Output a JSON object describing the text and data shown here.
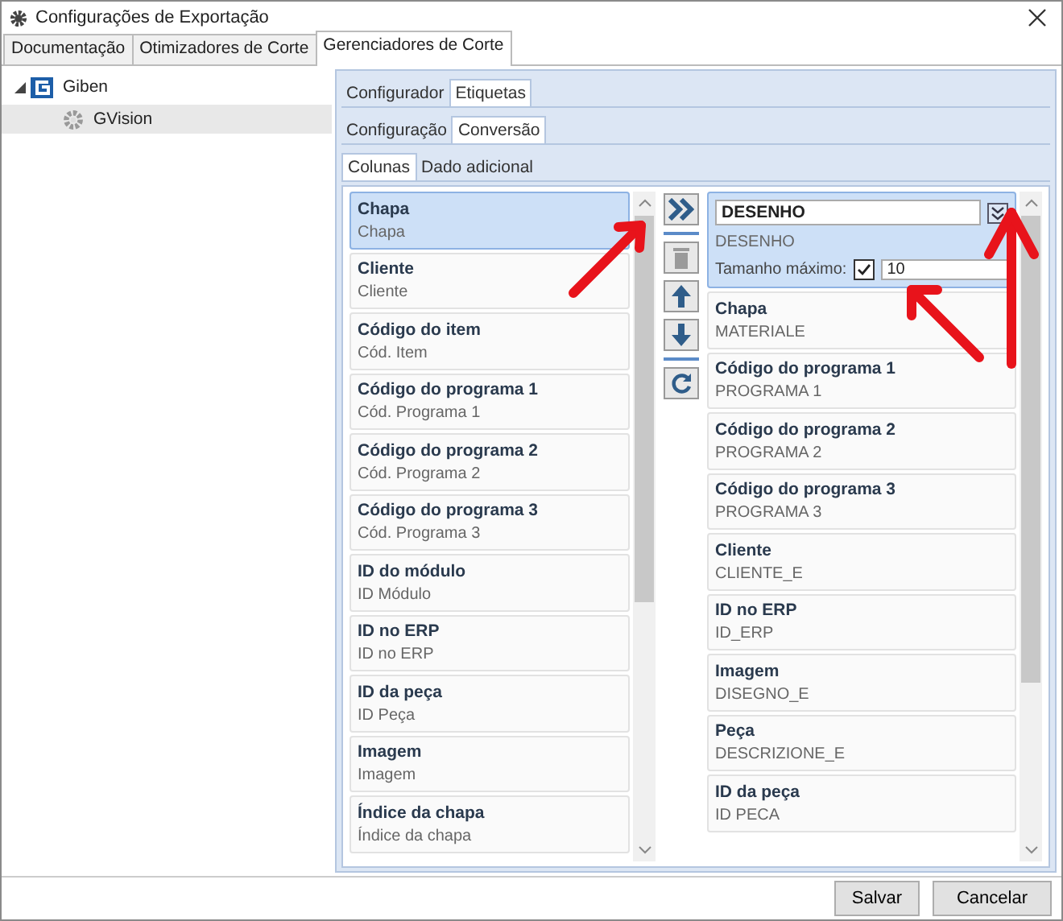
{
  "window": {
    "title": "Configurações de Exportação"
  },
  "tabs": [
    {
      "label": "Documentação",
      "selected": false
    },
    {
      "label": "Otimizadores de Corte",
      "selected": false
    },
    {
      "label": "Gerenciadores de Corte",
      "selected": true
    }
  ],
  "tree": [
    {
      "label": "Giben",
      "expanded": true,
      "selected": false,
      "children": [
        {
          "label": "GVision",
          "selected": true
        }
      ]
    }
  ],
  "tab_rows": [
    [
      {
        "label": "Configurador",
        "selected": false
      },
      {
        "label": "Etiquetas",
        "selected": true
      }
    ],
    [
      {
        "label": "Configuração",
        "selected": false
      },
      {
        "label": "Conversão",
        "selected": true
      }
    ],
    [
      {
        "label": "Colunas",
        "selected": true
      },
      {
        "label": "Dado adicional",
        "selected": false
      }
    ]
  ],
  "available_columns": [
    {
      "title": "Chapa",
      "subtitle": "Chapa",
      "selected": true
    },
    {
      "title": "Cliente",
      "subtitle": "Cliente",
      "selected": false
    },
    {
      "title": "Código do item",
      "subtitle": "Cód. Item",
      "selected": false
    },
    {
      "title": "Código do programa 1",
      "subtitle": "Cód. Programa 1",
      "selected": false
    },
    {
      "title": "Código do programa 2",
      "subtitle": "Cód. Programa 2",
      "selected": false
    },
    {
      "title": "Código do programa 3",
      "subtitle": "Cód. Programa 3",
      "selected": false
    },
    {
      "title": "ID do módulo",
      "subtitle": "ID Módulo",
      "selected": false
    },
    {
      "title": "ID no ERP",
      "subtitle": "ID no ERP",
      "selected": false
    },
    {
      "title": "ID da peça",
      "subtitle": "ID Peça",
      "selected": false
    },
    {
      "title": "Imagem",
      "subtitle": "Imagem",
      "selected": false
    },
    {
      "title": "Índice da chapa",
      "subtitle": "Índice da chapa",
      "selected": false
    }
  ],
  "tools": [
    {
      "kind": "add",
      "disabled": false
    },
    {
      "kind": "delete",
      "disabled": true
    },
    {
      "kind": "up",
      "disabled": false
    },
    {
      "kind": "down",
      "disabled": false
    },
    {
      "kind": "refresh",
      "disabled": false
    }
  ],
  "mapped_columns": [
    {
      "kind": "editor",
      "title": "DESENHO",
      "subtitle": "DESENHO",
      "max_length_label": "Tamanho máximo:",
      "max_length_checked": true,
      "max_length": "10",
      "selected": true
    },
    {
      "kind": "item",
      "title": "Chapa",
      "subtitle": "MATERIALE",
      "selected": false
    },
    {
      "kind": "item",
      "title": "Código do programa 1",
      "subtitle": "PROGRAMA 1",
      "selected": false
    },
    {
      "kind": "item",
      "title": "Código do programa 2",
      "subtitle": "PROGRAMA 2",
      "selected": false
    },
    {
      "kind": "item",
      "title": "Código do programa 3",
      "subtitle": "PROGRAMA 3",
      "selected": false
    },
    {
      "kind": "item",
      "title": "Cliente",
      "subtitle": "CLIENTE_E",
      "selected": false
    },
    {
      "kind": "item",
      "title": "ID no ERP",
      "subtitle": "ID_ERP",
      "selected": false
    },
    {
      "kind": "item",
      "title": "Imagem",
      "subtitle": "DISEGNO_E",
      "selected": false
    },
    {
      "kind": "item",
      "title": "Peça",
      "subtitle": "DESCRIZIONE_E",
      "selected": false
    },
    {
      "kind": "item",
      "title": "ID da peça",
      "subtitle": "ID PECA",
      "selected": false
    }
  ],
  "buttons": [
    "Salvar",
    "Cancelar"
  ]
}
